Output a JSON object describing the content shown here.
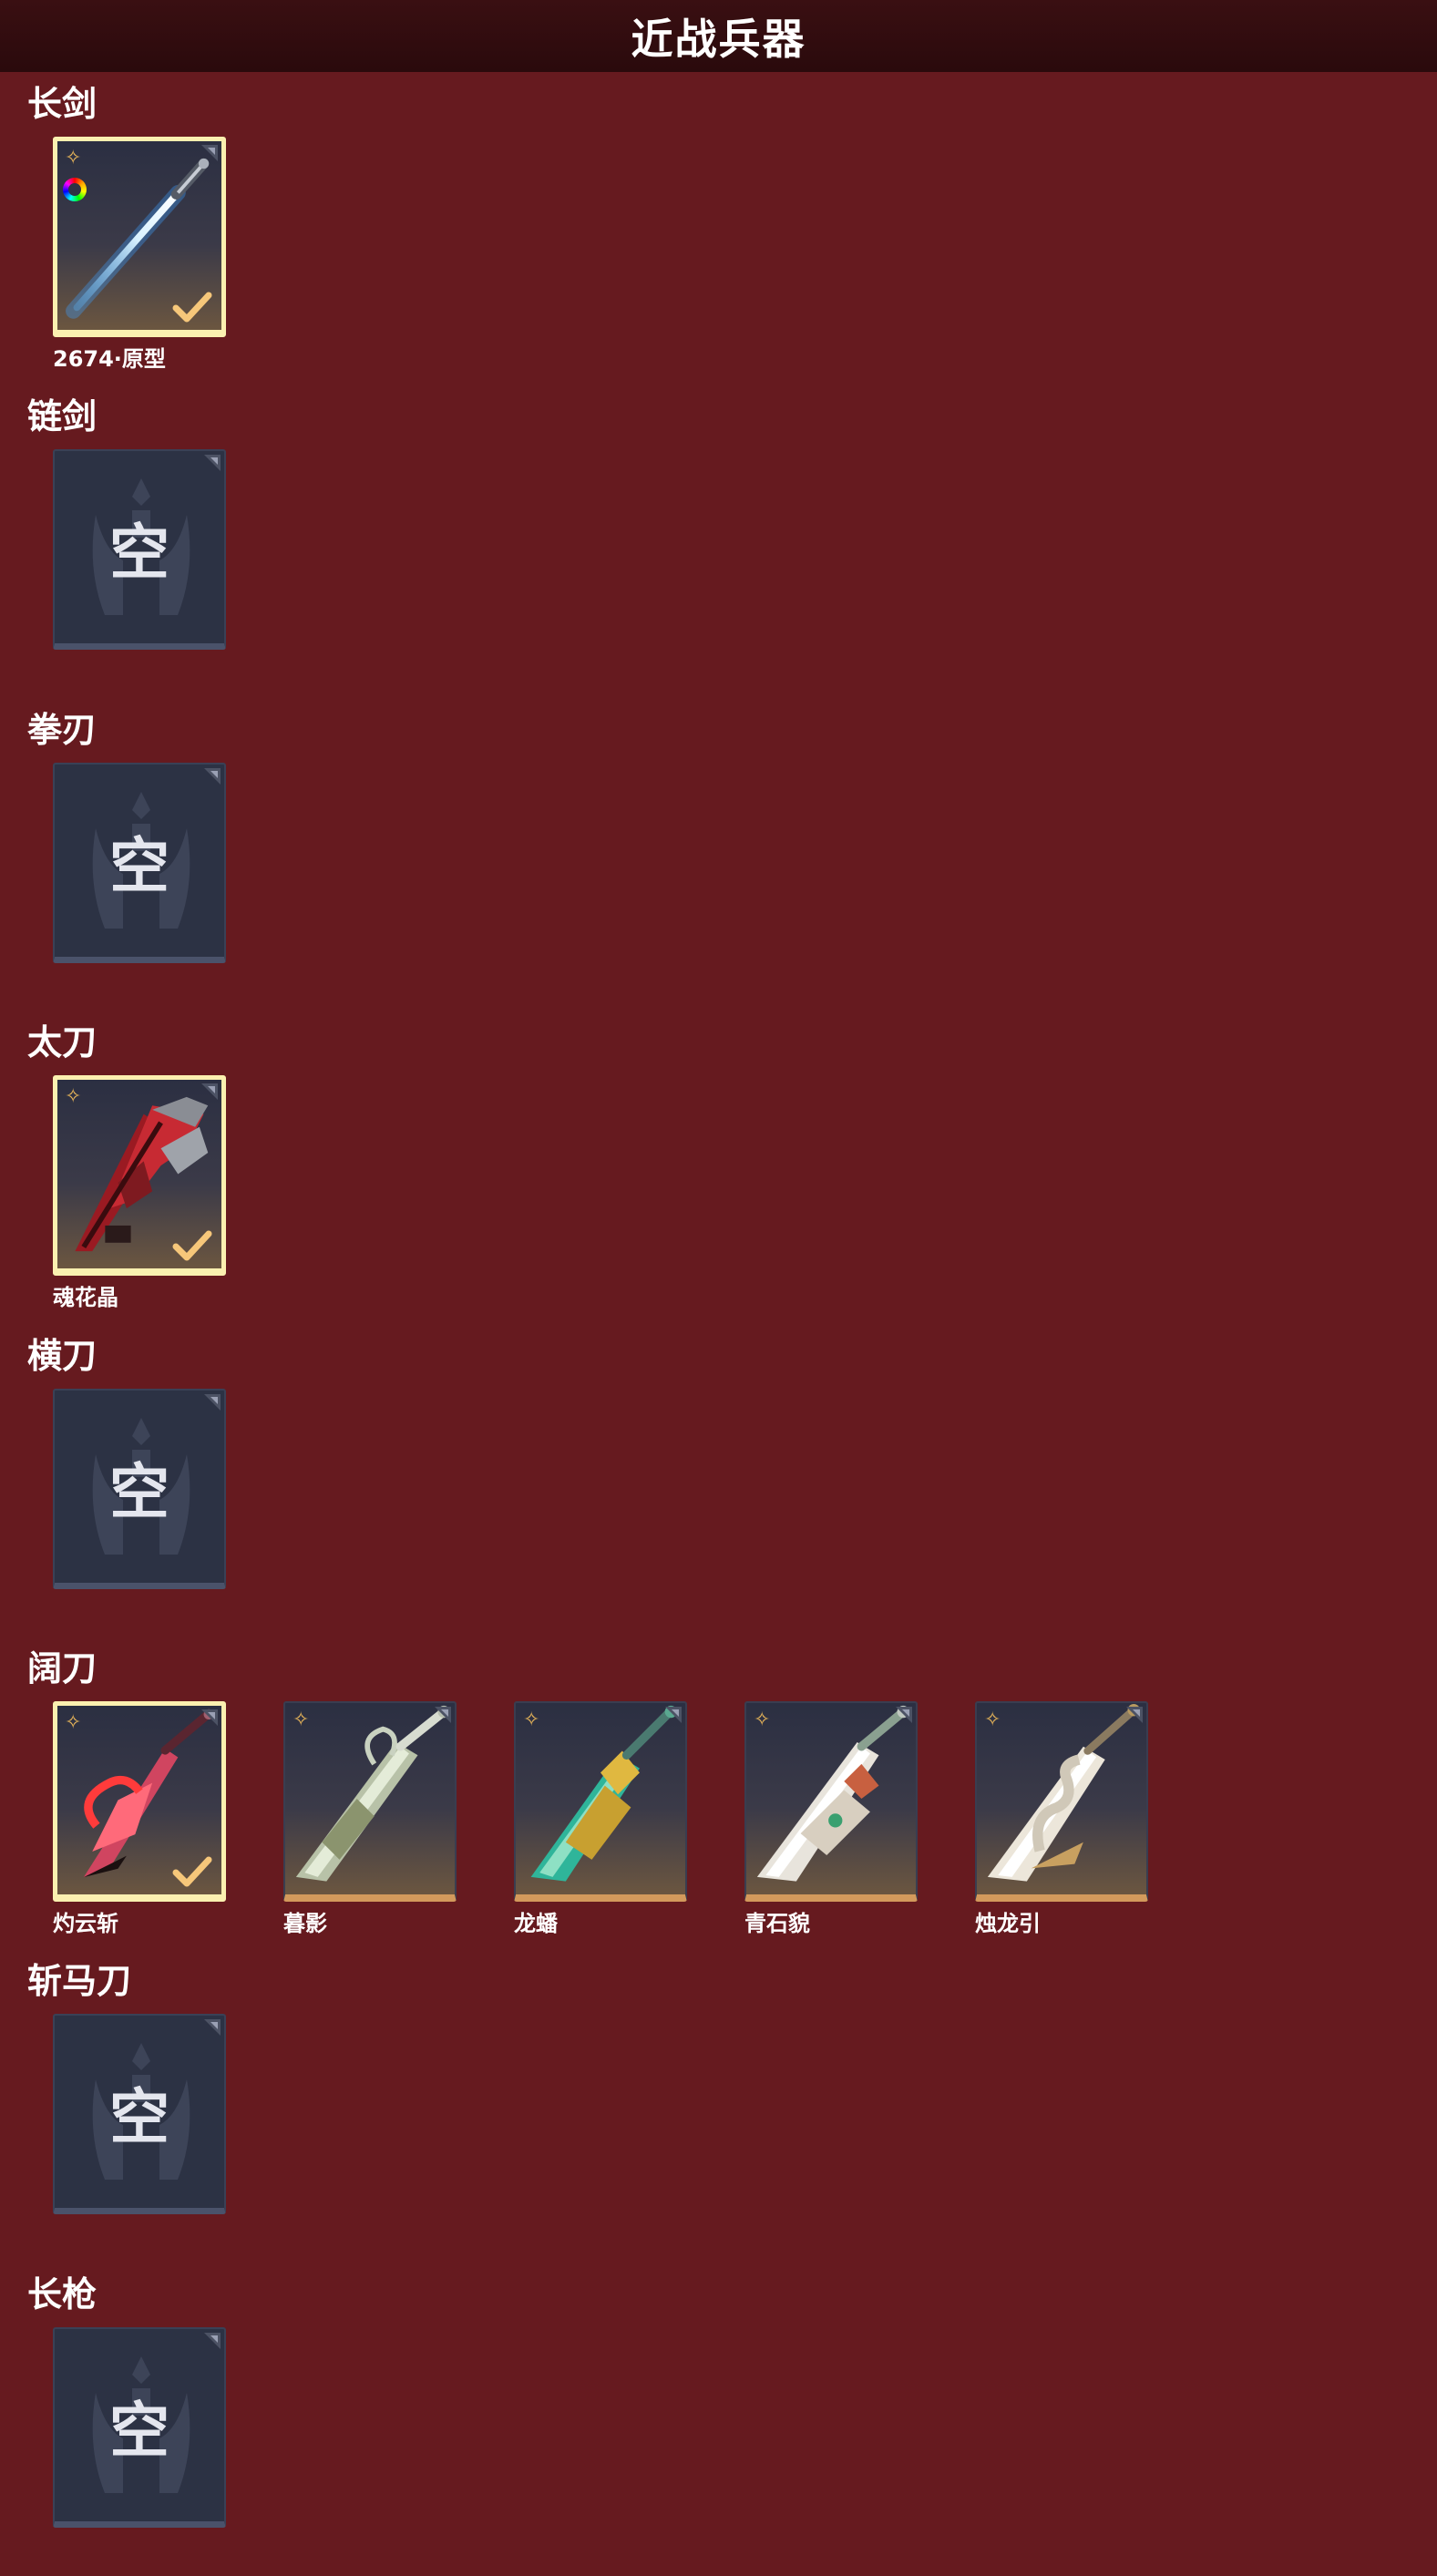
{
  "title": "近战兵器",
  "empty_label": "空",
  "categories": [
    {
      "name": "长剑",
      "items": [
        {
          "name": "2674·原型",
          "selected": true,
          "rainbow": true,
          "art": "blue-sword"
        }
      ]
    },
    {
      "name": "链剑",
      "items": []
    },
    {
      "name": "拳刃",
      "items": []
    },
    {
      "name": "太刀",
      "items": [
        {
          "name": "魂花晶",
          "selected": true,
          "art": "red-crystal-blade"
        }
      ]
    },
    {
      "name": "横刀",
      "items": []
    },
    {
      "name": "阔刀",
      "items": [
        {
          "name": "灼云斩",
          "selected": true,
          "art": "crimson-broadsword"
        },
        {
          "name": "暮影",
          "selected": false,
          "art": "silver-broadsword"
        },
        {
          "name": "龙蟠",
          "selected": false,
          "art": "jade-gold-broadsword"
        },
        {
          "name": "青石貌",
          "selected": false,
          "art": "white-jade-broadsword"
        },
        {
          "name": "烛龙引",
          "selected": false,
          "art": "white-dragon-broadsword"
        }
      ]
    },
    {
      "name": "斩马刀",
      "items": []
    },
    {
      "name": "长枪",
      "items": []
    }
  ],
  "colors": {
    "background": "#661a1f",
    "title_bar": "#2e0b0d",
    "selected_border": "#fbf0b0",
    "rarity_bottom": "#d39a5c",
    "empty_card": "#2c3244"
  }
}
